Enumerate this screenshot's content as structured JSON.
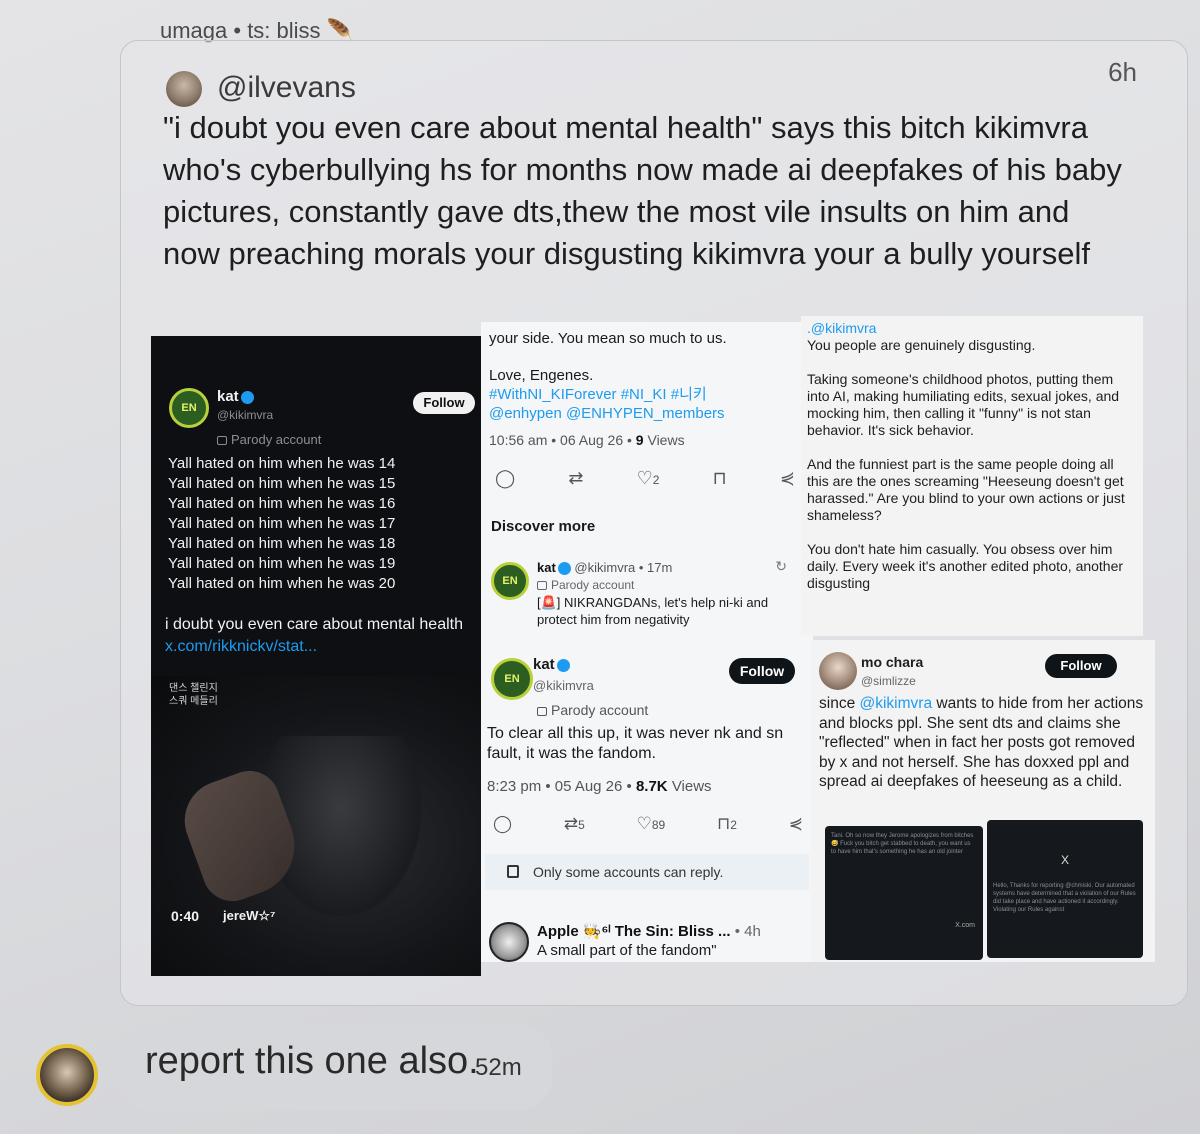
{
  "header": {
    "text": "umaga • ts: bliss",
    "emoji": "🪶"
  },
  "quote": {
    "handle": "@ilvevans",
    "time": "6h",
    "text": "\"i doubt you even care about mental health\" says this bitch kikimvra who's cyberbullying hs for months now made ai deepfakes of his baby pictures, constantly gave dts,thew the most vile insults on him and now preaching morals your disgusting kikimvra your a bully yourself"
  },
  "panel1": {
    "logo_text": "EN",
    "name": "kat",
    "handle": "@kikimvra",
    "follow": "Follow",
    "parody": "Parody account",
    "lines": [
      "Yall hated on him when he was 14",
      "Yall hated on him when he was 15",
      "Yall hated on him when he was 16",
      "Yall hated on him when he was 17",
      "Yall hated on him when he was 18",
      "Yall hated on him when he was 19",
      "Yall hated on him when he was 20"
    ],
    "body": "i doubt you even care about mental health",
    "link": "x.com/rikknickv/stat...",
    "video_tag_1": "댄스 챌린지",
    "video_tag_2": "스쿼 메들리",
    "duration": "0:40",
    "via_user": "jereW☆⁷"
  },
  "panel2": {
    "top_line": "your side. You mean so much to us.",
    "signoff": "Love, Engenes.",
    "hashtags": "#WithNI_KIForever #NI_KI #니키",
    "mentions": "@enhypen @ENHYPEN_members",
    "meta_time": "10:56 am • 06 Aug 26 •",
    "meta_views": "9",
    "meta_views_label": "Views",
    "likes": "2",
    "discover": "Discover more",
    "card1": {
      "logo_text": "EN",
      "name": "kat",
      "handle_time": "@kikimvra • 17m",
      "parody": "Parody account",
      "text": "[🚨] NIKRANGDANs, let's help ni-ki and protect him from negativity"
    },
    "card2": {
      "logo_text": "EN",
      "name": "kat",
      "handle": "@kikimvra",
      "follow": "Follow",
      "parody": "Parody account",
      "text": "To clear all this up, it was never nk and sn fault, it was the fandom.",
      "meta_time": "8:23 pm • 05 Aug 26 •",
      "views": "8.7K",
      "views_label": "Views",
      "retweets": "5",
      "likes": "89",
      "bookmarks": "2"
    },
    "reply_notice": "Only some accounts can reply.",
    "apple": {
      "name": "Apple 🧑‍🍳⁶ˡ The Sin: Bliss ...",
      "time": "• 4h",
      "text": "A small part of the fandom\""
    }
  },
  "panel3": {
    "mention": ".@kikimvra",
    "p1": "You people are genuinely disgusting.",
    "p2": "Taking someone's childhood photos, putting them into AI, making humiliating edits, sexual jokes, and mocking him, then calling it \"funny\" is not stan behavior. It's sick behavior.",
    "p3": "And the funniest part is the same people doing all this are the ones screaming \"Heeseung doesn't get harassed.\" Are you blind to your own actions or just shameless?",
    "p4": "You don't hate him casually. You obsess over him daily. Every week it's another edited photo, another disgusting"
  },
  "panel4": {
    "name": "mo chara",
    "handle": "@simlizze",
    "follow": "Follow",
    "text_pre": "since",
    "mention": "@kikimvra",
    "text_post": "wants to hide from her actions and blocks ppl. She sent dts and claims she \"reflected\" when in fact her posts got removed by x and not herself. She has doxxed ppl and spread ai deepfakes of heeseung as a child.",
    "shot1_text": "Tani. Oh so now they Jerome apologizes from bitches 😅 Fuck you bitch get stabbed to death, you want us to have him that's something he has an old jointer",
    "shot1_domain": "X.com",
    "shot2_x": "X",
    "shot2_text": "Hello, Thanks for reporting @chmiski. Our automated systems have determined that a violation of our Rules did take place and have actioned it accordingly. Violating our Rules against"
  },
  "reply": {
    "text": "report this one also.",
    "time": "52m"
  }
}
